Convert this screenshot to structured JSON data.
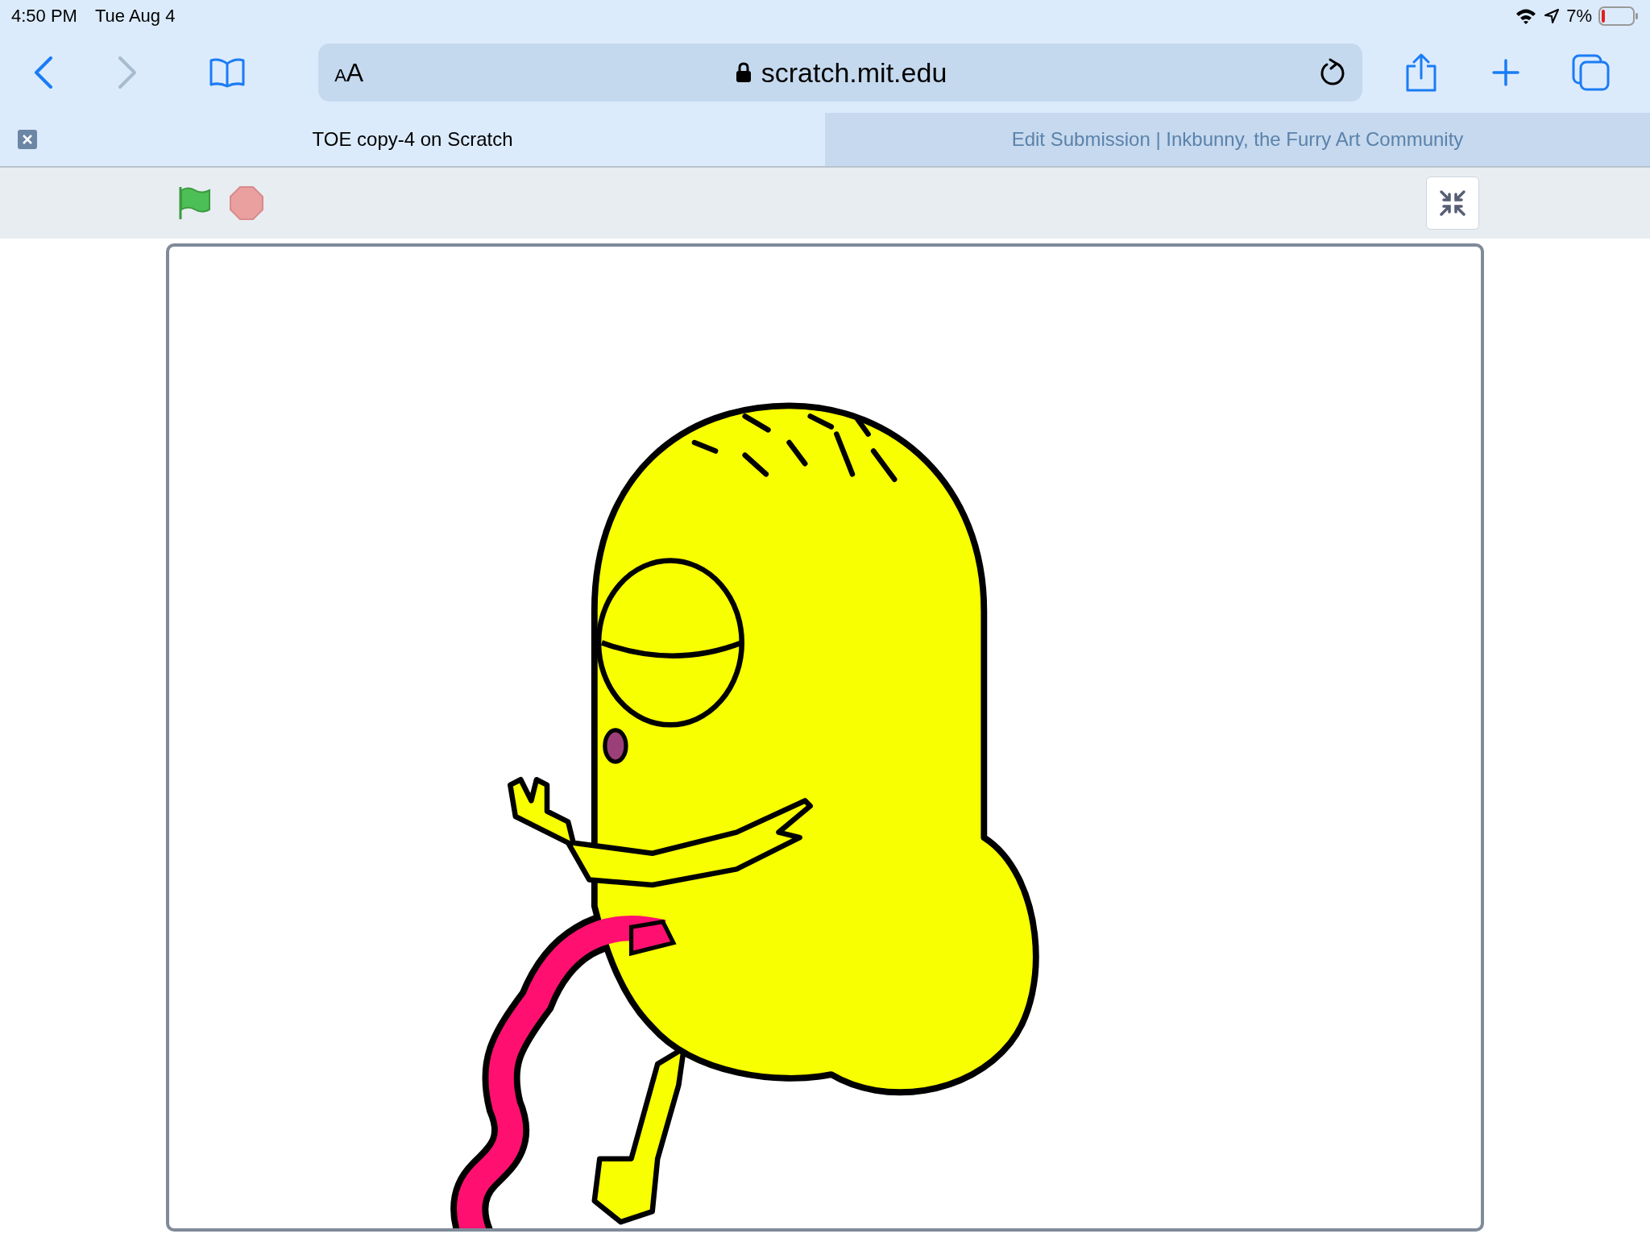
{
  "status_bar": {
    "time": "4:50 PM",
    "date": "Tue Aug 4",
    "battery_percent": "7%"
  },
  "toolbar": {
    "back": {
      "disabled": false
    },
    "forward": {
      "disabled": true
    },
    "text_size_label": "AA",
    "url": "scratch.mit.edu"
  },
  "tabs": [
    {
      "title": "TOE copy-4 on Scratch",
      "selected": true
    },
    {
      "title": "Edit Submission | Inkbunny, the Furry Art Community",
      "selected": false
    }
  ]
}
